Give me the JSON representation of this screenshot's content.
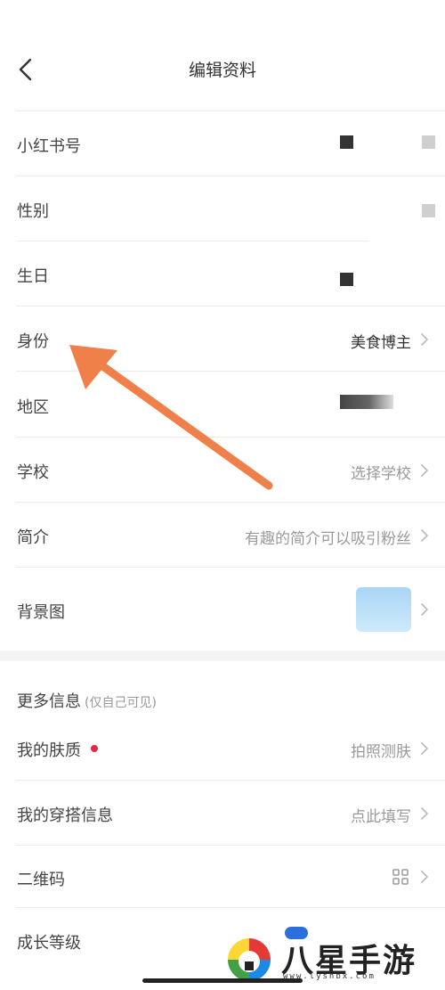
{
  "header": {
    "title": "编辑资料",
    "back_icon": "chevron-left-icon"
  },
  "rows": [
    {
      "label": "小红书号",
      "value": ""
    },
    {
      "label": "性别",
      "value": ""
    },
    {
      "label": "生日",
      "value": ""
    },
    {
      "label": "身份",
      "value": "美食博主"
    },
    {
      "label": "地区",
      "value": ""
    },
    {
      "label": "学校",
      "value": "选择学校"
    },
    {
      "label": "简介",
      "value": "有趣的简介可以吸引粉丝"
    },
    {
      "label": "背景图",
      "value": ""
    }
  ],
  "more_section": {
    "title": "更多信息",
    "subtitle": "(仅自己可见)"
  },
  "more_rows": [
    {
      "label": "我的肤质",
      "value": "拍照测肤"
    },
    {
      "label": "我的穿搭信息",
      "value": "点此填写"
    },
    {
      "label": "二维码",
      "value": ""
    },
    {
      "label": "成长等级",
      "value": ""
    }
  ],
  "watermark": {
    "text": "八星手游网",
    "url": "www.lyshbx.com"
  },
  "colors": {
    "accent_arrow": "#f0804a",
    "red_dot": "#e0294a",
    "divider": "#ececec"
  }
}
